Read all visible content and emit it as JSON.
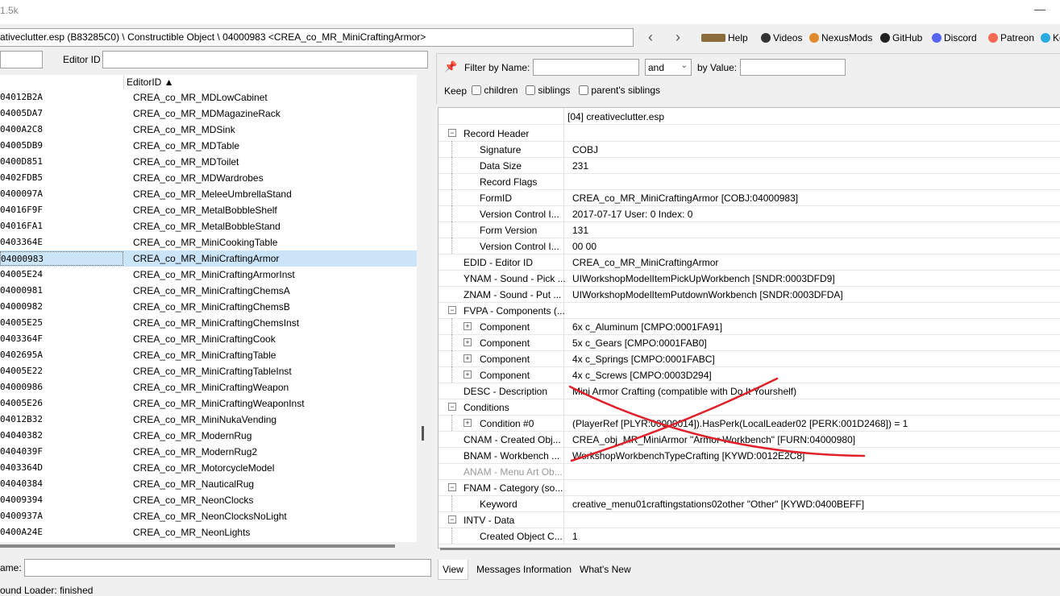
{
  "window": {
    "title": "1.5k",
    "minimize": "—"
  },
  "path": {
    "text": "ativeclutter.esp (B83285C0) \\ Constructible Object \\ 04000983 <CREA_co_MR_MiniCraftingArmor>"
  },
  "nav": {
    "back": "‹",
    "forward": "›"
  },
  "links": [
    {
      "label": "Help",
      "icon": "book-icon",
      "color": "#8a6d3b"
    },
    {
      "label": "Videos",
      "icon": "videos-icon",
      "color": "#333333"
    },
    {
      "label": "NexusMods",
      "icon": "nexusmods-icon",
      "color": "#e08a2c"
    },
    {
      "label": "GitHub",
      "icon": "github-icon",
      "color": "#222222"
    },
    {
      "label": "Discord",
      "icon": "discord-icon",
      "color": "#5865f2"
    },
    {
      "label": "Patreon",
      "icon": "patreon-icon",
      "color": "#f96854"
    },
    {
      "label": "Ko",
      "icon": "kofi-icon",
      "color": "#29abe0"
    }
  ],
  "left": {
    "editor_id_label": "Editor ID",
    "column_header": "EditorID ▲",
    "rows": [
      [
        "04012B2A",
        "CREA_co_MR_MDLowCabinet"
      ],
      [
        "04005DA7",
        "CREA_co_MR_MDMagazineRack"
      ],
      [
        "0400A2C8",
        "CREA_co_MR_MDSink"
      ],
      [
        "04005DB9",
        "CREA_co_MR_MDTable"
      ],
      [
        "0400D851",
        "CREA_co_MR_MDToilet"
      ],
      [
        "0402FDB5",
        "CREA_co_MR_MDWardrobes"
      ],
      [
        "0400097A",
        "CREA_co_MR_MeleeUmbrellaStand"
      ],
      [
        "04016F9F",
        "CREA_co_MR_MetalBobbleShelf"
      ],
      [
        "04016FA1",
        "CREA_co_MR_MetalBobbleStand"
      ],
      [
        "0403364E",
        "CREA_co_MR_MiniCookingTable"
      ],
      [
        "04000983",
        "CREA_co_MR_MiniCraftingArmor"
      ],
      [
        "04005E24",
        "CREA_co_MR_MiniCraftingArmorInst"
      ],
      [
        "04000981",
        "CREA_co_MR_MiniCraftingChemsA"
      ],
      [
        "04000982",
        "CREA_co_MR_MiniCraftingChemsB"
      ],
      [
        "04005E25",
        "CREA_co_MR_MiniCraftingChemsInst"
      ],
      [
        "0403364F",
        "CREA_co_MR_MiniCraftingCook"
      ],
      [
        "0402695A",
        "CREA_co_MR_MiniCraftingTable"
      ],
      [
        "04005E22",
        "CREA_co_MR_MiniCraftingTableInst"
      ],
      [
        "04000986",
        "CREA_co_MR_MiniCraftingWeapon"
      ],
      [
        "04005E26",
        "CREA_co_MR_MiniCraftingWeaponInst"
      ],
      [
        "04012B32",
        "CREA_co_MR_MiniNukaVending"
      ],
      [
        "04040382",
        "CREA_co_MR_ModernRug"
      ],
      [
        "0404039F",
        "CREA_co_MR_ModernRug2"
      ],
      [
        "0403364D",
        "CREA_co_MR_MotorcycleModel"
      ],
      [
        "04040384",
        "CREA_co_MR_NauticalRug"
      ],
      [
        "04009394",
        "CREA_co_MR_NeonClocks"
      ],
      [
        "0400937A",
        "CREA_co_MR_NeonClocksNoLight"
      ],
      [
        "0400A24E",
        "CREA_co_MR_NeonLights"
      ]
    ],
    "selected_index": 10,
    "name_label": "ame:"
  },
  "filter": {
    "pin_icon": "pin-icon",
    "filter_by_name": "Filter by Name:",
    "and": "and",
    "by_value": "by Value:",
    "keep": "Keep",
    "children": "children",
    "siblings": "siblings",
    "parents_siblings": "parent's siblings"
  },
  "tree": {
    "header_value": "[04] creativeclutter.esp",
    "rows": [
      {
        "name": "Record Header",
        "value": "",
        "level": 0,
        "exp": "minus"
      },
      {
        "name": "Signature",
        "value": "COBJ",
        "level": 1,
        "exp": ""
      },
      {
        "name": "Data Size",
        "value": "231",
        "level": 1,
        "exp": ""
      },
      {
        "name": "Record Flags",
        "value": "",
        "level": 1,
        "exp": ""
      },
      {
        "name": "FormID",
        "value": "CREA_co_MR_MiniCraftingArmor [COBJ:04000983]",
        "level": 1,
        "exp": ""
      },
      {
        "name": "Version Control I...",
        "value": "2017-07-17 User: 0 Index: 0",
        "level": 1,
        "exp": ""
      },
      {
        "name": "Form Version",
        "value": "131",
        "level": 1,
        "exp": ""
      },
      {
        "name": "Version Control I...",
        "value": "00 00",
        "level": 1,
        "exp": ""
      },
      {
        "name": "EDID - Editor ID",
        "value": "CREA_co_MR_MiniCraftingArmor",
        "level": 0,
        "exp": ""
      },
      {
        "name": "YNAM - Sound - Pick ...",
        "value": "UIWorkshopModelItemPickUpWorkbench [SNDR:0003DFD9]",
        "level": 0,
        "exp": ""
      },
      {
        "name": "ZNAM - Sound - Put ...",
        "value": "UIWorkshopModelItemPutdownWorkbench [SNDR:0003DFDA]",
        "level": 0,
        "exp": ""
      },
      {
        "name": "FVPA - Components (...",
        "value": "",
        "level": 0,
        "exp": "minus"
      },
      {
        "name": "Component",
        "value": "6x c_Aluminum [CMPO:0001FA91]",
        "level": 1,
        "exp": "plus"
      },
      {
        "name": "Component",
        "value": "5x c_Gears [CMPO:0001FAB0]",
        "level": 1,
        "exp": "plus"
      },
      {
        "name": "Component",
        "value": "4x c_Springs [CMPO:0001FABC]",
        "level": 1,
        "exp": "plus"
      },
      {
        "name": "Component",
        "value": "4x c_Screws [CMPO:0003D294]",
        "level": 1,
        "exp": "plus"
      },
      {
        "name": "DESC - Description",
        "value": "Mini Armor Crafting (compatible with Do It Yourshelf)",
        "level": 0,
        "exp": ""
      },
      {
        "name": "Conditions",
        "value": "",
        "level": 0,
        "exp": "minus"
      },
      {
        "name": "Condition #0",
        "value": "(PlayerRef [PLYR:00000014]).HasPerk(LocalLeader02 [PERK:001D2468]) = 1",
        "level": 1,
        "exp": "plus"
      },
      {
        "name": "CNAM - Created Obj...",
        "value": "CREA_obj_MR_MiniArmor \"Armor Workbench\" [FURN:04000980]",
        "level": 0,
        "exp": ""
      },
      {
        "name": "BNAM - Workbench ...",
        "value": "WorkshopWorkbenchTypeCrafting [KYWD:0012E2C8]",
        "level": 0,
        "exp": ""
      },
      {
        "name": "ANAM - Menu Art Ob...",
        "value": "",
        "level": 0,
        "exp": "",
        "gray": true
      },
      {
        "name": "FNAM - Category (so...",
        "value": "",
        "level": 0,
        "exp": "minus"
      },
      {
        "name": "Keyword",
        "value": "creative_menu01craftingstations02other \"Other\" [KYWD:0400BEFF]",
        "level": 1,
        "exp": ""
      },
      {
        "name": "INTV - Data",
        "value": "",
        "level": 0,
        "exp": "minus"
      },
      {
        "name": "Created Object C...",
        "value": "1",
        "level": 1,
        "exp": ""
      }
    ]
  },
  "tabs": [
    "View",
    "Messages",
    "Information",
    "What's New"
  ],
  "status": "ound Loader: finished",
  "colors": {
    "selection": "#cce4f7",
    "annotation": "#e0202a"
  }
}
